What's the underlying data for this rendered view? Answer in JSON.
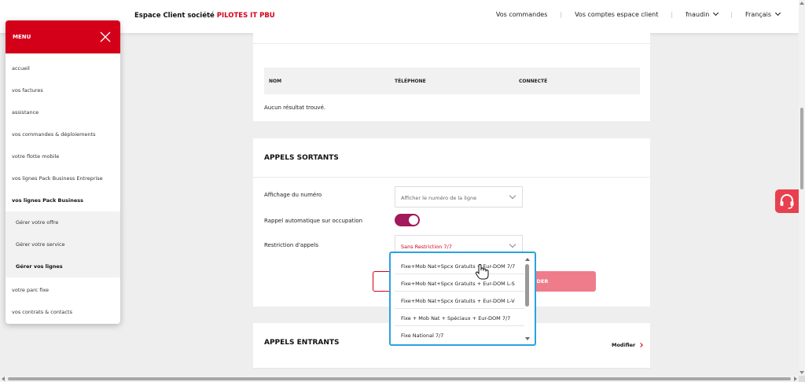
{
  "header": {
    "brand_prefix": "Espace Client société",
    "brand_company": "PILOTES IT PBU",
    "nav": {
      "orders": "Vos commandes",
      "separator": "|",
      "accounts": "Vos comptes espace client",
      "user": "fnaudin",
      "language": "Français"
    }
  },
  "menu": {
    "title": "MENU",
    "items": [
      {
        "label": "accueil"
      },
      {
        "label": "vos factures"
      },
      {
        "label": "assistance"
      },
      {
        "label": "vos commandes & déploiements"
      },
      {
        "label": "votre flotte mobile"
      },
      {
        "label": "vos lignes Pack Business Entreprise"
      },
      {
        "label": "vos lignes Pack Business"
      },
      {
        "label": "Gérer votre offre"
      },
      {
        "label": "Gérer votre service"
      },
      {
        "label": "Gérer vos lignes"
      },
      {
        "label": "votre parc fixe"
      },
      {
        "label": "vos contrats & contacts"
      }
    ]
  },
  "contacts_table": {
    "columns": [
      "NOM",
      "TÉLÉPHONE",
      "CONNECTÉ"
    ],
    "empty_message": "Aucun résultat trouvé."
  },
  "outgoing_calls": {
    "title": "APPELS SORTANTS",
    "number_display_label": "Affichage du numéro",
    "number_display_value": "Afficher le numéro de la ligne",
    "auto_callback_label": "Rappel automatique sur occupation",
    "auto_callback_on": true,
    "restriction_label": "Restriction d'appels",
    "restriction_value": "Sans Restriction 7/7",
    "validate_label": "VALIDER",
    "validate_visible_text": "LIDER"
  },
  "restriction_options": [
    "Fixe+Mob Nat+Spcx Gratuits + Eur-DOM 7/7",
    "Fixe+Mob Nat+Spcx Gratuits + Eur-DOM L-S",
    "Fixe+Mob Nat+Spcx Gratuits + Eur-DOM L-V",
    "Fixe + Mob Nat + Spéciaux + Eur-DOM 7/7",
    "Fixe National 7/7"
  ],
  "incoming_calls": {
    "title": "APPELS ENTRANTS",
    "modify_label": "Modifier"
  },
  "colors": {
    "brand_red": "#d4001a",
    "toggle_on": "#a3195b",
    "validate_button": "#ef7c8a",
    "dropdown_border": "#29a3df",
    "help_button": "#e8404f"
  },
  "icons": {
    "close": "close-icon",
    "chevron": "chevron-down-icon",
    "help": "headset-icon",
    "cursor": "hand-pointer-icon"
  }
}
